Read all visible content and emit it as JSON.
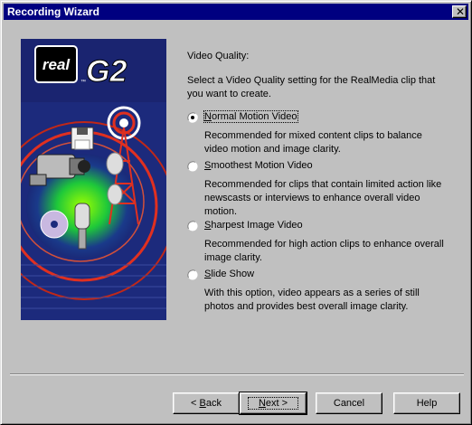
{
  "window": {
    "title": "Recording Wizard",
    "close_glyph": "✕"
  },
  "art": {
    "brand": "real",
    "brand_suffix": "G2",
    "tm": "™"
  },
  "content": {
    "heading": "Video Quality:",
    "instruction_line1": "Select a Video Quality setting for the RealMedia clip that",
    "instruction_line2": "you want to create."
  },
  "options": [
    {
      "label_mnemonic": "N",
      "label_rest": "ormal Motion Video",
      "selected": true,
      "desc": [
        "Recommended for mixed content clips to balance",
        "video motion and image clarity."
      ]
    },
    {
      "label_mnemonic": "S",
      "label_rest": "moothest Motion Video",
      "selected": false,
      "desc": [
        "Recommended for clips that contain limited action like",
        "newscasts or interviews to enhance overall video",
        "motion."
      ]
    },
    {
      "label_mnemonic": "S",
      "label_rest": "harpest Image Video",
      "selected": false,
      "desc": [
        "Recommended for high action clips to enhance overall",
        "image clarity."
      ]
    },
    {
      "label_mnemonic": "S",
      "label_rest": "lide Show",
      "selected": false,
      "desc": [
        "With this option, video appears as a series of still",
        "photos and provides best overall image clarity."
      ]
    }
  ],
  "buttons": {
    "back_prefix": "< ",
    "back_mnemonic": "B",
    "back_rest": "ack",
    "next_mnemonic": "N",
    "next_rest": "ext >",
    "cancel": "Cancel",
    "help": "Help"
  }
}
